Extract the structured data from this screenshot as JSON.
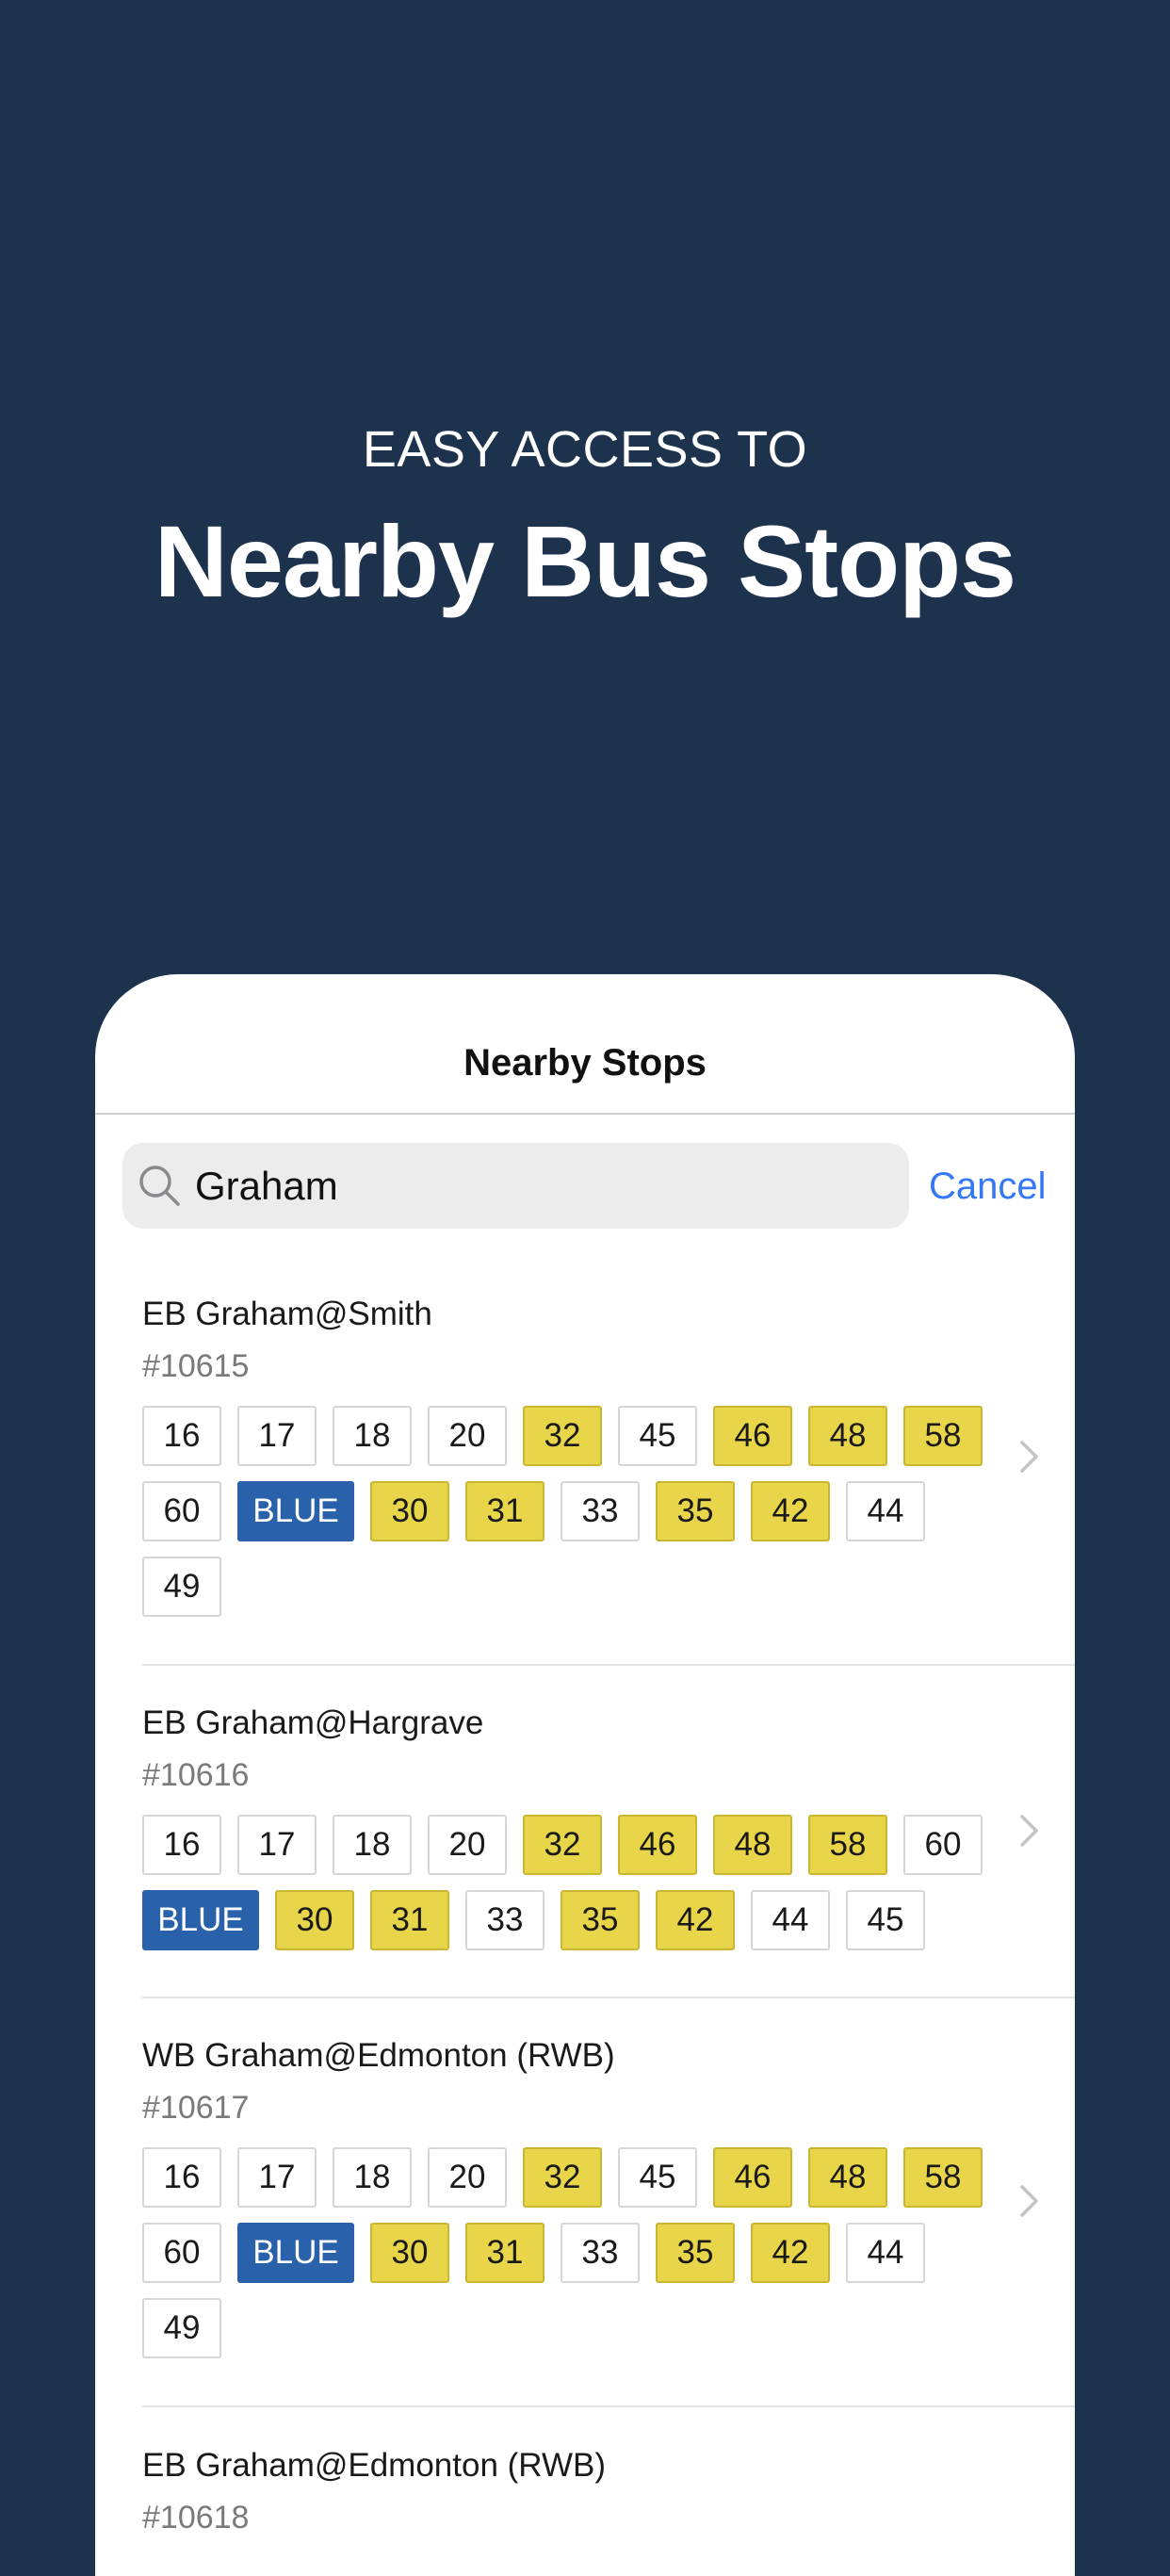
{
  "hero": {
    "subtitle": "EASY ACCESS TO",
    "title": "Nearby Bus Stops"
  },
  "screen": {
    "title": "Nearby Stops"
  },
  "search": {
    "value": "Graham",
    "cancel_label": "Cancel",
    "icon": "search-icon"
  },
  "colors": {
    "background": "#1d324d",
    "yellow_route": "#e9d54a",
    "blue_route": "#2962aa",
    "accent": "#3478f6"
  },
  "stops": [
    {
      "name": "EB Graham@Smith",
      "id": "#10615",
      "routes": [
        {
          "label": "16",
          "style": "plain"
        },
        {
          "label": "17",
          "style": "plain"
        },
        {
          "label": "18",
          "style": "plain"
        },
        {
          "label": "20",
          "style": "plain"
        },
        {
          "label": "32",
          "style": "yellow"
        },
        {
          "label": "45",
          "style": "plain"
        },
        {
          "label": "46",
          "style": "yellow"
        },
        {
          "label": "48",
          "style": "yellow"
        },
        {
          "label": "58",
          "style": "yellow"
        },
        {
          "label": "60",
          "style": "plain"
        },
        {
          "label": "BLUE",
          "style": "blue"
        },
        {
          "label": "30",
          "style": "yellow"
        },
        {
          "label": "31",
          "style": "yellow"
        },
        {
          "label": "33",
          "style": "plain"
        },
        {
          "label": "35",
          "style": "yellow"
        },
        {
          "label": "42",
          "style": "yellow"
        },
        {
          "label": "44",
          "style": "plain"
        },
        {
          "label": "49",
          "style": "plain"
        }
      ]
    },
    {
      "name": "EB Graham@Hargrave",
      "id": "#10616",
      "routes": [
        {
          "label": "16",
          "style": "plain"
        },
        {
          "label": "17",
          "style": "plain"
        },
        {
          "label": "18",
          "style": "plain"
        },
        {
          "label": "20",
          "style": "plain"
        },
        {
          "label": "32",
          "style": "yellow"
        },
        {
          "label": "46",
          "style": "yellow"
        },
        {
          "label": "48",
          "style": "yellow"
        },
        {
          "label": "58",
          "style": "yellow"
        },
        {
          "label": "60",
          "style": "plain"
        },
        {
          "label": "BLUE",
          "style": "blue"
        },
        {
          "label": "30",
          "style": "yellow"
        },
        {
          "label": "31",
          "style": "yellow"
        },
        {
          "label": "33",
          "style": "plain"
        },
        {
          "label": "35",
          "style": "yellow"
        },
        {
          "label": "42",
          "style": "yellow"
        },
        {
          "label": "44",
          "style": "plain"
        },
        {
          "label": "45",
          "style": "plain"
        }
      ]
    },
    {
      "name": "WB Graham@Edmonton (RWB)",
      "id": "#10617",
      "routes": [
        {
          "label": "16",
          "style": "plain"
        },
        {
          "label": "17",
          "style": "plain"
        },
        {
          "label": "18",
          "style": "plain"
        },
        {
          "label": "20",
          "style": "plain"
        },
        {
          "label": "32",
          "style": "yellow"
        },
        {
          "label": "45",
          "style": "plain"
        },
        {
          "label": "46",
          "style": "yellow"
        },
        {
          "label": "48",
          "style": "yellow"
        },
        {
          "label": "58",
          "style": "yellow"
        },
        {
          "label": "60",
          "style": "plain"
        },
        {
          "label": "BLUE",
          "style": "blue"
        },
        {
          "label": "30",
          "style": "yellow"
        },
        {
          "label": "31",
          "style": "yellow"
        },
        {
          "label": "33",
          "style": "plain"
        },
        {
          "label": "35",
          "style": "yellow"
        },
        {
          "label": "42",
          "style": "yellow"
        },
        {
          "label": "44",
          "style": "plain"
        },
        {
          "label": "49",
          "style": "plain"
        }
      ]
    },
    {
      "name": "EB Graham@Edmonton (RWB)",
      "id": "#10618",
      "routes": []
    }
  ]
}
